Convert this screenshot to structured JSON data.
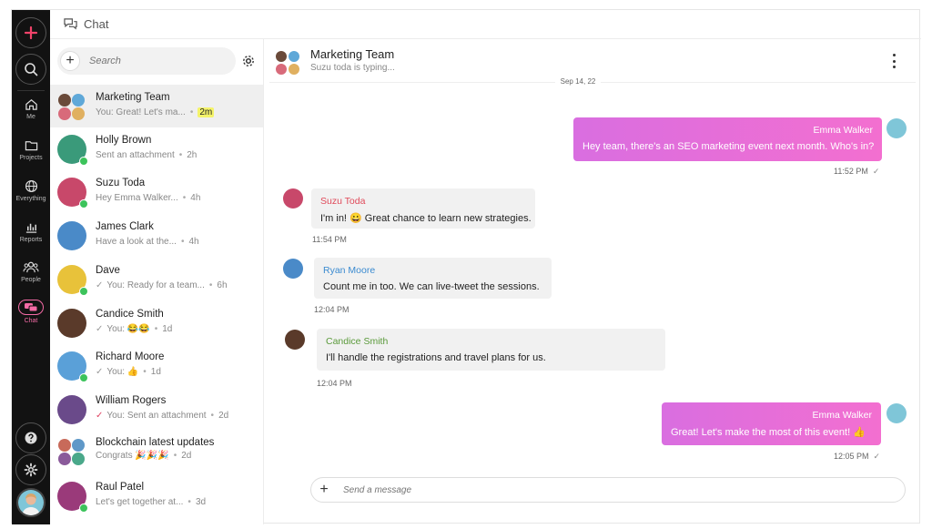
{
  "colors": {
    "accent": "#f46ba6",
    "online": "#3cc35b",
    "rail_bg": "#121212",
    "bubble_out_start": "#d96ee0",
    "bubble_out_end": "#f36fd0"
  },
  "header": {
    "title": "Chat"
  },
  "rail": {
    "items": [
      {
        "label": "Me",
        "icon": "home-icon"
      },
      {
        "label": "Projects",
        "icon": "folder-icon"
      },
      {
        "label": "Everything",
        "icon": "globe-icon"
      },
      {
        "label": "Reports",
        "icon": "bar-chart-icon"
      },
      {
        "label": "People",
        "icon": "people-icon"
      },
      {
        "label": "Chat",
        "icon": "chat-icon"
      }
    ]
  },
  "search": {
    "placeholder": "Search"
  },
  "conversations": [
    {
      "name": "Marketing Team",
      "preview": "You: Great! Let's ma...",
      "time": "2m"
    },
    {
      "name": "Holly Brown",
      "preview": "Sent an attachment",
      "time": "2h"
    },
    {
      "name": "Suzu Toda",
      "preview": "Hey Emma Walker...",
      "time": "4h"
    },
    {
      "name": "James Clark",
      "preview": "Have a look at the...",
      "time": "4h"
    },
    {
      "name": "Dave",
      "preview": "You: Ready for a team...",
      "time": "6h"
    },
    {
      "name": "Candice Smith",
      "preview": "You: 😂😂",
      "time": "1d"
    },
    {
      "name": "Richard Moore",
      "preview": "You: 👍",
      "time": "1d"
    },
    {
      "name": "William Rogers",
      "preview": "You: Sent an attachment",
      "time": "2d"
    },
    {
      "name": "Blockchain latest updates",
      "preview": "Congrats 🎉🎉🎉",
      "time": "2d"
    },
    {
      "name": "Raul Patel",
      "preview": "Let's get together at...",
      "time": "3d"
    }
  ],
  "conversation": {
    "title": "Marketing Team",
    "status": "Suzu toda is typing...",
    "date": "Sep 14, 22",
    "messages": [
      {
        "sender": "Emma Walker",
        "text": "Hey team, there's an SEO marketing event next month. Who's in?",
        "time": "11:52 PM"
      },
      {
        "sender": "Suzu Toda",
        "text": "I'm in! 😀 Great chance to learn new strategies.",
        "time": "11:54 PM"
      },
      {
        "sender": "Ryan Moore",
        "text": "Count me in too. We can live-tweet the sessions.",
        "time": "12:04 PM"
      },
      {
        "sender": "Candice Smith",
        "text": "I'll handle the registrations and travel plans for us.",
        "time": "12:04 PM"
      },
      {
        "sender": "Emma Walker",
        "text": "Great! Let's make the most of this event! 👍",
        "time": "12:05 PM"
      }
    ]
  },
  "composer": {
    "placeholder": "Send a message"
  }
}
